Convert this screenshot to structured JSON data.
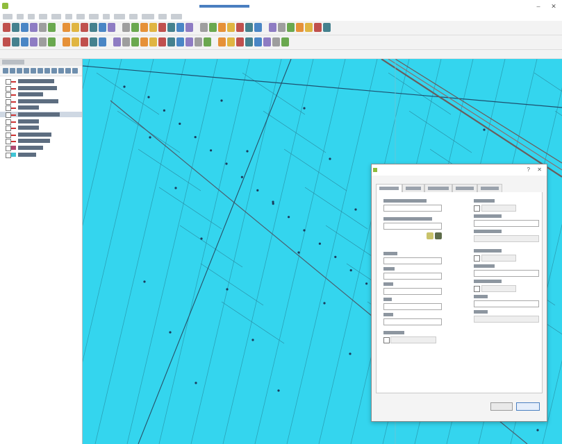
{
  "window": {
    "title": "",
    "minimize_icon": "–",
    "close_icon": "✕"
  },
  "menu": {
    "items": [
      "",
      "",
      "",
      "",
      "",
      "",
      "",
      "",
      "",
      "",
      "",
      "",
      "",
      ""
    ]
  },
  "layers_panel": {
    "title": "",
    "layers": [
      {
        "name": "",
        "symbol_color": "#cc3333",
        "selected": false
      },
      {
        "name": "",
        "symbol_color": "#cc3333",
        "selected": false
      },
      {
        "name": "",
        "symbol_color": "#cc3333",
        "selected": false
      },
      {
        "name": "",
        "symbol_color": "#cc3333",
        "selected": false
      },
      {
        "name": "",
        "symbol_color": "#cc3333",
        "selected": false
      },
      {
        "name": "",
        "symbol_color": "#cc3333",
        "selected": true
      },
      {
        "name": "",
        "symbol_color": "#cc3333",
        "selected": false
      },
      {
        "name": "",
        "symbol_color": "#cc3333",
        "selected": false
      },
      {
        "name": "",
        "symbol_color": "#cc3333",
        "selected": false
      },
      {
        "name": "",
        "symbol_color": "#cc3333",
        "selected": false
      },
      {
        "name": "",
        "symbol_color": "#b04870",
        "selected": false
      },
      {
        "name": "",
        "symbol_color": "#41c6d6",
        "selected": false
      }
    ]
  },
  "map": {
    "background_color": "#34d5ee"
  },
  "dialog": {
    "title": "",
    "help_icon": "?",
    "close_icon": "✕",
    "tabs": [
      {
        "label": "",
        "active": true
      },
      {
        "label": "",
        "active": false
      },
      {
        "label": "",
        "active": false
      },
      {
        "label": "",
        "active": false
      },
      {
        "label": "",
        "active": false
      }
    ],
    "left_fields": [
      {
        "label": "",
        "value": ""
      },
      {
        "label": "",
        "value": ""
      },
      {
        "label": "",
        "value": ""
      },
      {
        "label": "",
        "value": ""
      },
      {
        "label": "",
        "value": ""
      },
      {
        "label": "",
        "value": ""
      },
      {
        "label": "",
        "value": ""
      },
      {
        "label": "",
        "value": ""
      }
    ],
    "right_fields": [
      {
        "label": "",
        "value": "",
        "kind": "check"
      },
      {
        "label": "",
        "value": "",
        "kind": "stepper"
      },
      {
        "label": "",
        "value": "",
        "kind": "dropdown"
      },
      {
        "label": "",
        "value": "",
        "kind": "check"
      },
      {
        "label": "",
        "value": "",
        "kind": "dropdown"
      },
      {
        "label": "",
        "value": "",
        "kind": "check"
      },
      {
        "label": "",
        "value": "",
        "kind": "stepper"
      },
      {
        "label": "",
        "value": "",
        "kind": "dropdown"
      }
    ],
    "ok_label": "",
    "close_label": ""
  }
}
